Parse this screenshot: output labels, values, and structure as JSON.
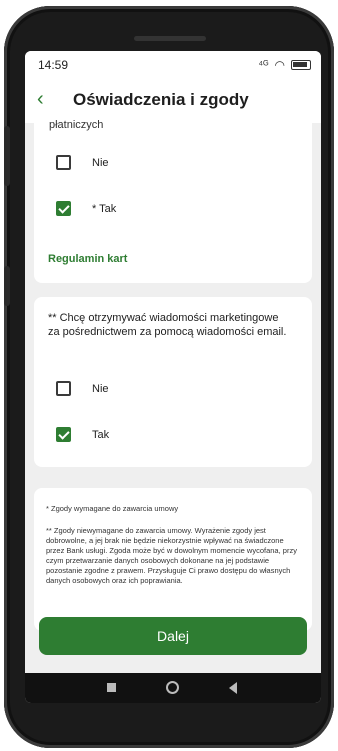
{
  "status": {
    "time": "14:59",
    "signal": "⁴ᴳ",
    "wifi": "◠"
  },
  "header": {
    "title": "Oświadczenia i zgody"
  },
  "card1": {
    "cut_text": "płatniczych",
    "options": [
      {
        "label": "Nie",
        "checked": false
      },
      {
        "label": "* Tak",
        "checked": true
      }
    ],
    "link": "Regulamin kart"
  },
  "card2": {
    "text": "** Chcę otrzymywać wiadomości marketingowe za pośrednictwem za pomocą wiadomości email.",
    "options": [
      {
        "label": "Nie",
        "checked": false
      },
      {
        "label": "Tak",
        "checked": true
      }
    ]
  },
  "notes": {
    "required": "* Zgody wymagane do zawarcia umowy",
    "optional": "** Zgody niewymagane do zawarcia umowy. Wyrażenie zgody jest dobrowolne, a jej brak nie będzie niekorzystnie wpływać na świadczone przez Bank usługi. Zgoda może być w dowolnym momencie wycofana, przy czym przetwarzanie danych osobowych dokonane na jej podstawie pozostanie zgodne z prawem. Przysługuje Ci prawo dostępu do własnych danych osobowych oraz ich poprawiania."
  },
  "buttons": {
    "next": "Dalej"
  }
}
